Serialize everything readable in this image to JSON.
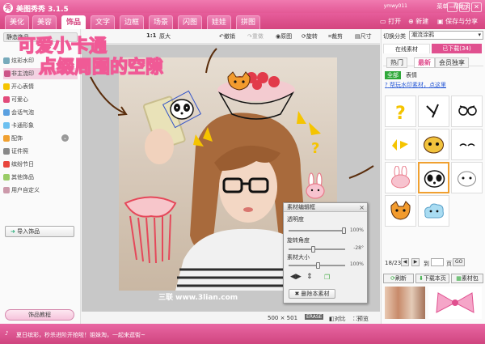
{
  "app": {
    "title": "美图秀秀 3.1.5",
    "logo": "秀",
    "user": "ymwy011",
    "menu_label": "菜单",
    "help_label": "帮助页"
  },
  "window_controls": [
    "—",
    "□",
    "✕"
  ],
  "main_tabs": [
    "美化",
    "美容",
    "饰品",
    "文字",
    "边框",
    "场景",
    "闪图",
    "娃娃",
    "拼图"
  ],
  "top_actions": {
    "open": "打开",
    "new": "新建",
    "save": "保存与分享"
  },
  "left_panel": {
    "header": "静态饰品",
    "items": [
      "炫彩水印",
      "非主流印",
      "开心表情",
      "可爱心",
      "会话气泡",
      "卡通形象",
      "配饰",
      "证件照",
      "缤纷节日",
      "其他饰品",
      "用户自定义"
    ],
    "selected": "卡通形象",
    "import_btn": "导入饰品",
    "tutorial_btn": "饰品教程"
  },
  "toolbar": {
    "ratio": "1:1",
    "original_size": "原大",
    "undo": "撤销",
    "redo": "重做",
    "original": "原图",
    "rotate": "旋转",
    "crop": "裁剪",
    "size": "尺寸"
  },
  "canvas": {
    "overlay_line1": "可爱小卡通",
    "overlay_line2": "点缀周围的空隙",
    "watermark": "三联 www.3lian.com"
  },
  "dialog": {
    "title": "素材编辑框",
    "transparency_label": "透明度",
    "transparency_value": "100%",
    "rotation_label": "旋转角度",
    "rotation_value": "-28°",
    "size_label": "素材大小",
    "size_value": "100%",
    "delete_btn": "删除本素材"
  },
  "canvas_status": {
    "dims": "500 × 501",
    "erase": "ERASE",
    "compare": "对比",
    "preview": "预览"
  },
  "right_panel": {
    "category_label": "切换分类",
    "category_value": "潮流涂鸦",
    "tab_online": "在线素材",
    "tab_downloaded": "已下载(34)",
    "subtabs": [
      "热门",
      "最新",
      "会员独享"
    ],
    "filter_all": "全部",
    "filter_emoji": "表情",
    "help_link": "帮玩水印素材，点这里",
    "page_counter": "18/23",
    "goto_label": "到",
    "page_suffix": "页",
    "go_btn": "GO",
    "refresh_btn": "刷新",
    "download_page_btn": "下载本页",
    "material_pack_btn": "素材包"
  },
  "status_message": "夏日缤彩，秒杀进阶开抢啦！姐妹淘，一起来逛街~",
  "colors": {
    "brand_pink": "#e0508f",
    "accent_green": "#2fa83a",
    "selection_orange": "#f0a030"
  }
}
